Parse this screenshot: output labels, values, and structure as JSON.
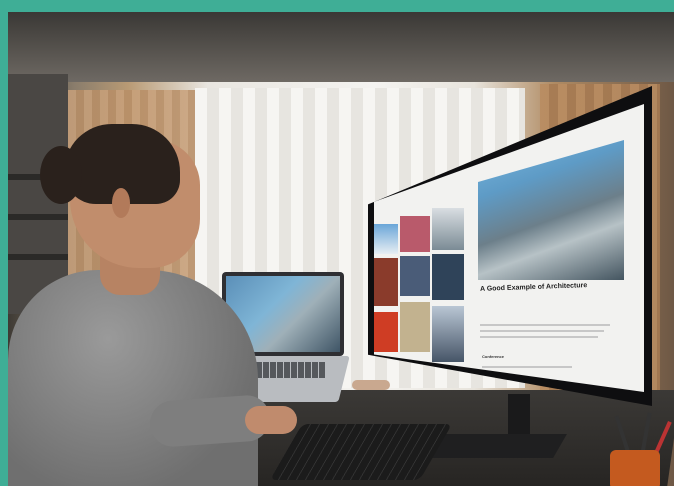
{
  "image": {
    "monitor": {
      "screen_title": "A Good Example of Architecture",
      "screen_subheading": "Conference"
    }
  }
}
